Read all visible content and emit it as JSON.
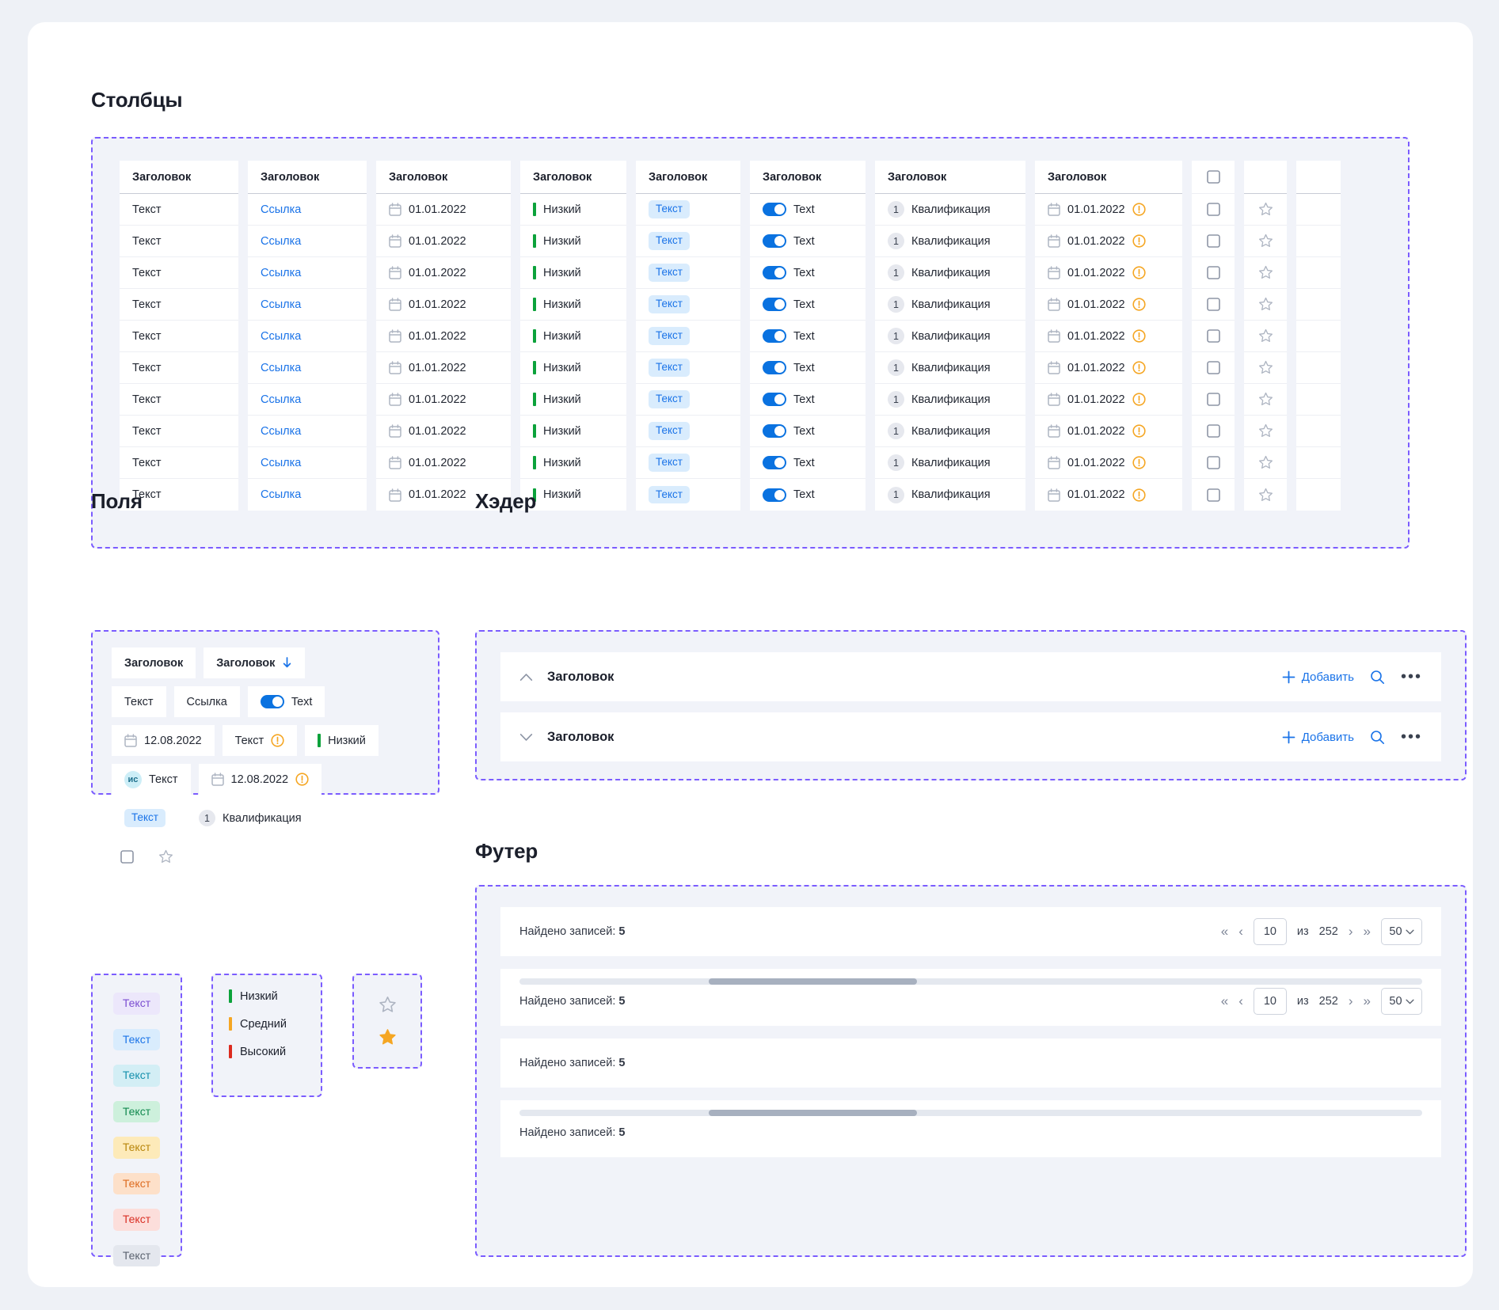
{
  "sections": {
    "columns_title": "Столбцы",
    "fields_title": "Поля",
    "header_title": "Хэдер",
    "footer_title": "Футер"
  },
  "table": {
    "header_label": "Заголовок",
    "row_count": 10,
    "columns": [
      {
        "name": "text",
        "header": "Заголовок",
        "type": "text",
        "value": "Текст"
      },
      {
        "name": "link",
        "header": "Заголовок",
        "type": "link",
        "value": "Ссылка"
      },
      {
        "name": "date",
        "header": "Заголовок",
        "type": "date",
        "value": "01.01.2022"
      },
      {
        "name": "priority",
        "header": "Заголовок",
        "type": "priority",
        "value": "Низкий",
        "color": "#0ca23b"
      },
      {
        "name": "tag",
        "header": "Заголовок",
        "type": "tag",
        "value": "Текст"
      },
      {
        "name": "toggle",
        "header": "Заголовок",
        "type": "toggle",
        "value": "Text"
      },
      {
        "name": "qualif",
        "header": "Заголовок",
        "type": "counter",
        "value": "Квалификация",
        "badge": "1"
      },
      {
        "name": "date-warn",
        "header": "Заголовок",
        "type": "date-warning",
        "value": "01.01.2022"
      },
      {
        "name": "checkbox",
        "header": "",
        "type": "checkbox",
        "value": ""
      },
      {
        "name": "star",
        "header": "",
        "type": "star",
        "value": ""
      },
      {
        "name": "empty",
        "header": "",
        "type": "empty",
        "value": ""
      }
    ]
  },
  "fields": {
    "header_plain": "Заголовок",
    "header_sorted": "Заголовок",
    "text": "Текст",
    "link": "Ссылка",
    "toggle_label": "Text",
    "date": "12.08.2022",
    "text_warning": "Текст",
    "priority": "Низкий",
    "initials": "ис",
    "avatar_text": "Текст",
    "date_warning": "12.08.2022",
    "tag": "Текст",
    "qualification": "Квалификация",
    "qualification_badge": "1"
  },
  "tags": [
    {
      "label": "Текст",
      "bg": "#ece7fb",
      "fg": "#7b4ed1"
    },
    {
      "label": "Текст",
      "bg": "#d9ecfd",
      "fg": "#1a73e8"
    },
    {
      "label": "Текст",
      "bg": "#d3eef5",
      "fg": "#1590ad"
    },
    {
      "label": "Текст",
      "bg": "#cdf0dc",
      "fg": "#12894f"
    },
    {
      "label": "Текст",
      "bg": "#fdeab9",
      "fg": "#b8860b"
    },
    {
      "label": "Текст",
      "bg": "#fde0c9",
      "fg": "#dd6b20"
    },
    {
      "label": "Текст",
      "bg": "#fcdedb",
      "fg": "#d93025"
    },
    {
      "label": "Текст",
      "bg": "#e4e7ee",
      "fg": "#5b6370"
    }
  ],
  "priorities": [
    {
      "label": "Низкий",
      "color": "#0ca23b"
    },
    {
      "label": "Средний",
      "color": "#f5a623"
    },
    {
      "label": "Высокий",
      "color": "#dc2b1f"
    }
  ],
  "stars": {
    "empty_name": "star-outline",
    "filled_name": "star-filled",
    "filled_color": "#f5a623"
  },
  "header": {
    "rows": [
      {
        "chevron": "up",
        "title": "Заголовок",
        "add_label": "Добавить"
      },
      {
        "chevron": "down",
        "title": "Заголовок",
        "add_label": "Добавить"
      }
    ]
  },
  "footer": {
    "found_label": "Найдено записей:",
    "found_count": "5",
    "page_value": "10",
    "of_label": "из",
    "total": "252",
    "page_size": "50",
    "rows": [
      {
        "pagination": true,
        "scrollbar": false
      },
      {
        "pagination": true,
        "scrollbar": true
      },
      {
        "pagination": false,
        "scrollbar": false
      },
      {
        "pagination": false,
        "scrollbar": true
      }
    ]
  }
}
